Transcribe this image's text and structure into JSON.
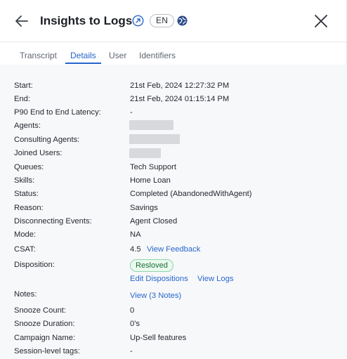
{
  "header": {
    "title": "Insights to Logs",
    "language": "EN"
  },
  "tabs": [
    {
      "label": "Transcript",
      "active": false
    },
    {
      "label": "Details",
      "active": true
    },
    {
      "label": "User",
      "active": false
    },
    {
      "label": "Identifiers",
      "active": false
    }
  ],
  "details": {
    "start": {
      "label": "Start:",
      "value": "21st Feb, 2024 12:27:32 PM"
    },
    "end": {
      "label": "End:",
      "value": "21st Feb, 2024 01:15:14 PM"
    },
    "p90": {
      "label": "P90 End to End Latency:",
      "value": "-"
    },
    "agents": {
      "label": "Agents:"
    },
    "consulting_agents": {
      "label": "Consulting Agents:"
    },
    "joined_users": {
      "label": "Joined Users:"
    },
    "queues": {
      "label": "Queues:",
      "value": "Tech Support"
    },
    "skills": {
      "label": "Skills:",
      "value": "Home Loan"
    },
    "status": {
      "label": "Status:",
      "value": "Completed (AbandonedWithAgent)"
    },
    "reason": {
      "label": "Reason:",
      "value": "Savings"
    },
    "disconnecting_events": {
      "label": "Disconnecting Events:",
      "value": "Agent Closed"
    },
    "mode": {
      "label": "Mode:",
      "value": "NA"
    },
    "csat": {
      "label": "CSAT:",
      "value": "4.5",
      "link": "View Feedback"
    },
    "disposition": {
      "label": "Disposition:",
      "badge": "Resloved",
      "edit_link": "Edit Dispositions",
      "logs_link": "View Logs"
    },
    "notes": {
      "label": "Notes:",
      "link": "View (3 Notes)"
    },
    "snooze_count": {
      "label": "Snooze Count:",
      "value": "0"
    },
    "snooze_duration": {
      "label": "Snooze Duration:",
      "value": "0's"
    },
    "campaign_name": {
      "label": "Campaign Name:",
      "value": "Up-Sell features"
    },
    "session_tags": {
      "label": "Session-level tags:",
      "value": "-"
    }
  },
  "colors": {
    "accent": "#2563c9",
    "badge_green": "#1c6b36",
    "redacted": "#d7d9dc"
  },
  "icons": [
    "back-arrow-icon",
    "external-link-icon",
    "globe-icon",
    "close-icon"
  ]
}
